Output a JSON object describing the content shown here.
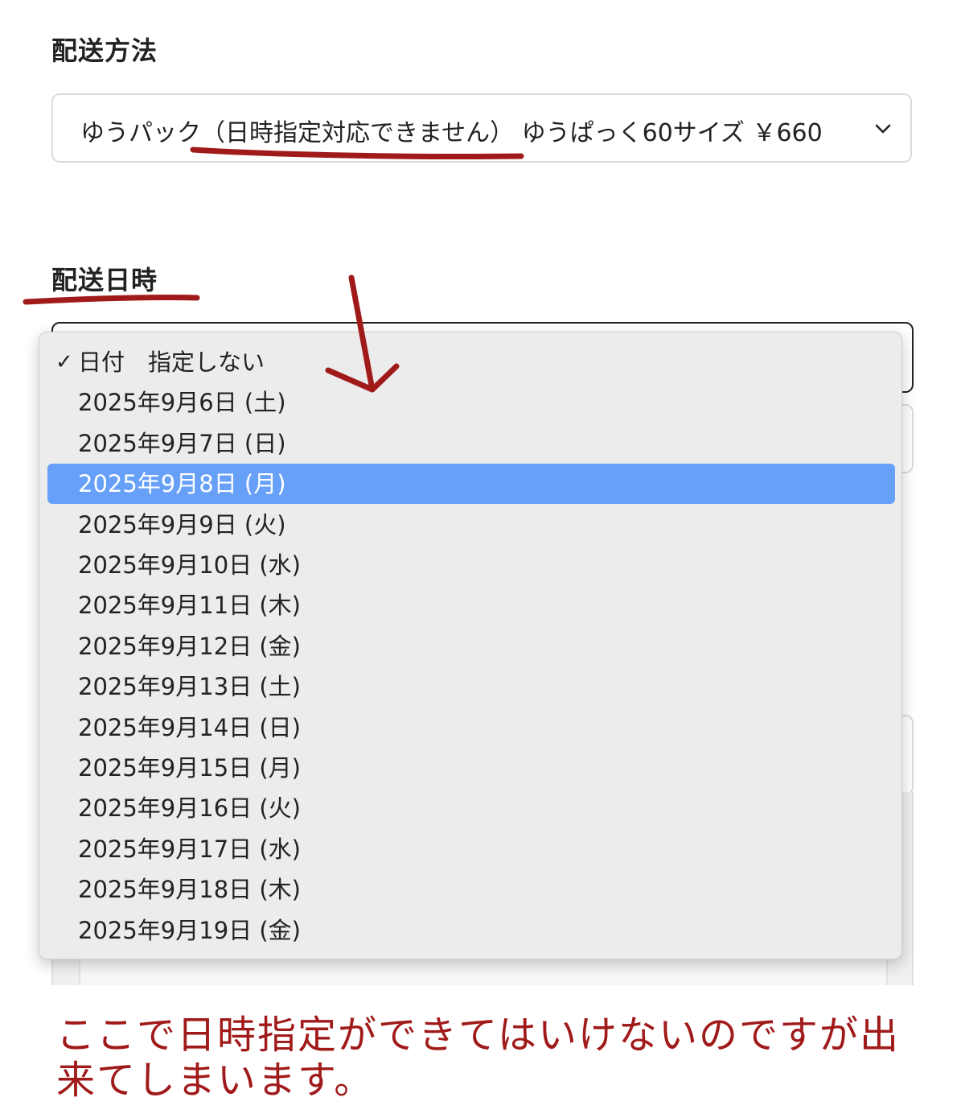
{
  "shipping_method": {
    "title": "配送方法",
    "selected_value": "ゆうパック（日時指定対応できません） ゆうぱっく60サイズ ￥660"
  },
  "delivery_datetime": {
    "title": "配送日時",
    "date_options": [
      {
        "label": "日付　指定しない",
        "checked": true,
        "highlighted": false
      },
      {
        "label": "2025年9月6日 (土)",
        "checked": false,
        "highlighted": false
      },
      {
        "label": "2025年9月7日 (日)",
        "checked": false,
        "highlighted": false
      },
      {
        "label": "2025年9月8日 (月)",
        "checked": false,
        "highlighted": true
      },
      {
        "label": "2025年9月9日 (火)",
        "checked": false,
        "highlighted": false
      },
      {
        "label": "2025年9月10日 (水)",
        "checked": false,
        "highlighted": false
      },
      {
        "label": "2025年9月11日 (木)",
        "checked": false,
        "highlighted": false
      },
      {
        "label": "2025年9月12日 (金)",
        "checked": false,
        "highlighted": false
      },
      {
        "label": "2025年9月13日 (土)",
        "checked": false,
        "highlighted": false
      },
      {
        "label": "2025年9月14日 (日)",
        "checked": false,
        "highlighted": false
      },
      {
        "label": "2025年9月15日 (月)",
        "checked": false,
        "highlighted": false
      },
      {
        "label": "2025年9月16日 (火)",
        "checked": false,
        "highlighted": false
      },
      {
        "label": "2025年9月17日 (水)",
        "checked": false,
        "highlighted": false
      },
      {
        "label": "2025年9月18日 (木)",
        "checked": false,
        "highlighted": false
      },
      {
        "label": "2025年9月19日 (金)",
        "checked": false,
        "highlighted": false
      }
    ],
    "check_mark": "✓"
  },
  "annotation": {
    "note": "ここで日時指定ができてはいけないのですが出来てしまいます。",
    "color": "#a11a1a"
  },
  "colors": {
    "highlight": "#67a0f8",
    "dropdown_bg": "#ececec"
  },
  "icons": {
    "method_select": "chevron-down-icon",
    "selected_option": "checkmark-icon"
  }
}
